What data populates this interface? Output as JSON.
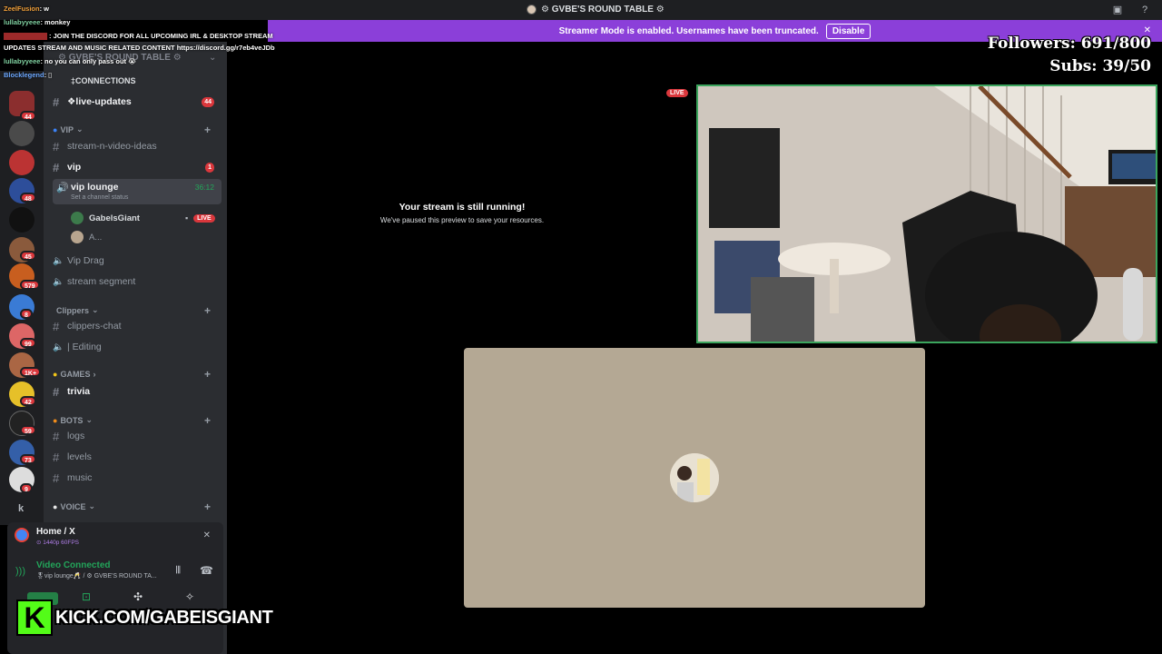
{
  "titlebar": {
    "server_name": "⚙ GVBE'S ROUND TABLE ⚙"
  },
  "banner": {
    "message": "Streamer Mode is enabled. Usernames have been truncated.",
    "disable_label": "Disable",
    "close": "✕"
  },
  "stats": {
    "followers": "Followers: 691/800",
    "subs": "Subs: 39/50"
  },
  "chat": [
    {
      "user": "ZeelFusion",
      "user_color": "#f2a03a",
      "text": ": w"
    },
    {
      "user": "lullabyyeee",
      "user_color": "#7fd0a0",
      "text": ": monkey"
    },
    {
      "user": "",
      "user_color": "#ffffff",
      "text": ": JOIN THE DISCORD FOR ALL UPCOMING IRL & DESKTOP STREAM"
    },
    {
      "user": "",
      "user_color": "#ffffff",
      "text": "UPDATES STREAM AND MUSIC RELATED CONTENT https://discord.gg/r7eb4veJDb"
    },
    {
      "user": "lullabyyeee",
      "user_color": "#7fd0a0",
      "text": ": no you can only pass out 😭"
    },
    {
      "user": "Blocklegend",
      "user_color": "#6da8ff",
      "text": ": ▯"
    }
  ],
  "sidebar": {
    "server_header": "⚙ GVBE'S ROUND TABLE ⚙",
    "channels": [
      {
        "name": "‡CONNECTIONS",
        "type": "category-text"
      },
      {
        "name": "❖live-updates",
        "type": "text",
        "count": "44"
      },
      {
        "name": "VIP",
        "type": "category"
      },
      {
        "name": "stream-n-video-ideas",
        "type": "text"
      },
      {
        "name": "vip",
        "type": "text",
        "count": "1"
      },
      {
        "name": "vip lounge",
        "type": "voice",
        "time": "36:12",
        "status": "Set a channel status"
      },
      {
        "name": "Vip Drag",
        "type": "voice"
      },
      {
        "name": "stream segment",
        "type": "voice"
      },
      {
        "name": "Clippers",
        "type": "category"
      },
      {
        "name": "clippers-chat",
        "type": "text"
      },
      {
        "name": "| Editing",
        "type": "voice"
      },
      {
        "name": "GAMES",
        "type": "category"
      },
      {
        "name": "trivia",
        "type": "text"
      },
      {
        "name": "BOTS",
        "type": "category"
      },
      {
        "name": "logs",
        "type": "text"
      },
      {
        "name": "levels",
        "type": "text"
      },
      {
        "name": "music",
        "type": "text"
      },
      {
        "name": "VOICE",
        "type": "category"
      }
    ],
    "voice_users": [
      {
        "name": "GabelsGiant",
        "live": "LIVE"
      },
      {
        "name": "A..."
      }
    ],
    "rail_badges": [
      "44",
      "48",
      "45",
      "579",
      "8",
      "99",
      "1K+",
      "42",
      "59",
      "73",
      "9"
    ],
    "rail_letter": "k"
  },
  "voice_panel": {
    "stream_title": "Home / X",
    "stream_quality": "⊙ 1440p 60FPS",
    "connected": "Video Connected",
    "channel_path": "🎖vip lounge🥂 / ⚙ GVBE'S ROUND TA..."
  },
  "stream": {
    "heading": "Your stream is still running!",
    "sub": "We've paused this preview to save your resources.",
    "live": "LIVE"
  },
  "kick": {
    "logo": "K",
    "url": "KICK.COM/GABEISGIANT"
  }
}
